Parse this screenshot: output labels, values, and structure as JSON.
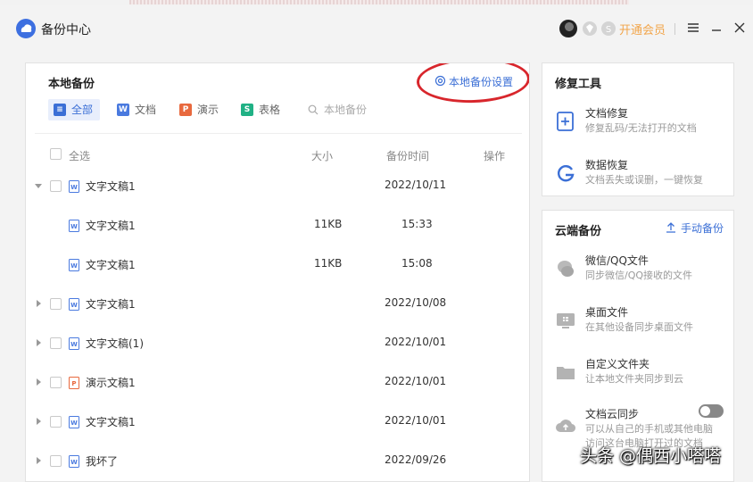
{
  "window": {
    "title": "备份中心",
    "vip_label": "开通会员"
  },
  "colors": {
    "accent": "#3b6fd6",
    "vip": "#f2a54a",
    "writer": "#4a7adf",
    "presentation": "#e8693e",
    "spreadsheet": "#20b185",
    "annotation": "#d8262c"
  },
  "local_backup": {
    "title": "本地备份",
    "settings_label": "本地备份设置",
    "filters": [
      {
        "label": "全部",
        "icon": "list-icon"
      },
      {
        "label": "文档",
        "icon": "W"
      },
      {
        "label": "演示",
        "icon": "P"
      },
      {
        "label": "表格",
        "icon": "S"
      }
    ],
    "search_placeholder": "本地备份",
    "columns": {
      "select_all": "全选",
      "size": "大小",
      "time": "备份时间",
      "action": "操作"
    },
    "rows": [
      {
        "name": "文字文稿1",
        "size": "",
        "time": "2022/10/11",
        "type": "writer",
        "expanded": true
      },
      {
        "name": "文字文稿1",
        "size": "11KB",
        "time": "15:33",
        "type": "writer",
        "child": true
      },
      {
        "name": "文字文稿1",
        "size": "11KB",
        "time": "15:08",
        "type": "writer",
        "child": true
      },
      {
        "name": "文字文稿1",
        "size": "",
        "time": "2022/10/08",
        "type": "writer"
      },
      {
        "name": "文字文稿(1)",
        "size": "",
        "time": "2022/10/01",
        "type": "writer"
      },
      {
        "name": "演示文稿1",
        "size": "",
        "time": "2022/10/01",
        "type": "presentation"
      },
      {
        "name": "文字文稿1",
        "size": "",
        "time": "2022/10/01",
        "type": "writer"
      },
      {
        "name": "我坏了",
        "size": "",
        "time": "2022/09/26",
        "type": "writer"
      }
    ]
  },
  "repair_tools": {
    "title": "修复工具",
    "items": [
      {
        "title": "文档修复",
        "desc": "修复乱码/无法打开的文档",
        "icon": "doc-repair-icon"
      },
      {
        "title": "数据恢复",
        "desc": "文档丢失或误删，一键恢复",
        "icon": "data-recovery-icon"
      }
    ]
  },
  "cloud_backup": {
    "title": "云端备份",
    "manual_label": "手动备份",
    "items": [
      {
        "title": "微信/QQ文件",
        "desc": "同步微信/QQ接收的文件",
        "icon": "chat-icon"
      },
      {
        "title": "桌面文件",
        "desc": "在其他设备同步桌面文件",
        "icon": "desktop-icon"
      },
      {
        "title": "自定义文件夹",
        "desc": "让本地文件夹同步到云",
        "icon": "folder-icon"
      },
      {
        "title": "文档云同步",
        "desc": "可以从自己的手机或其他电脑",
        "desc2": "访问这台电脑打开过的文档",
        "icon": "cloud-upload-icon",
        "toggle": false
      }
    ]
  },
  "watermark": "头条 @偶西小嗒嗒"
}
